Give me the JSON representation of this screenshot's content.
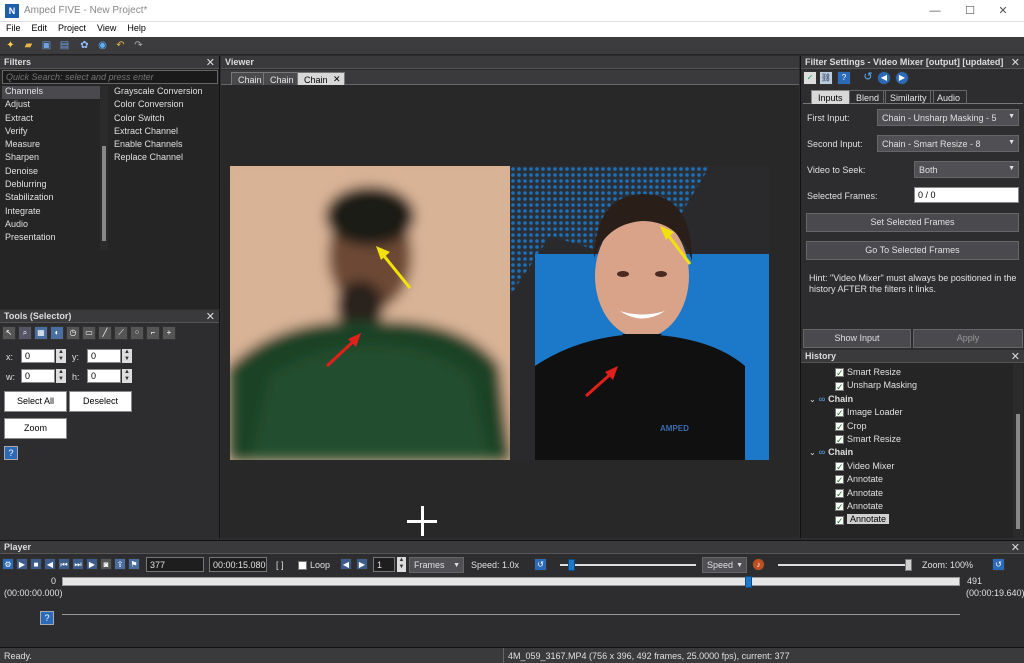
{
  "window": {
    "app_icon": "amped-logo-icon",
    "title": "Amped FIVE - New Project*",
    "controls": {
      "minimize": "—",
      "maximize": "☐",
      "close": "✕"
    }
  },
  "menu": [
    "File",
    "Edit",
    "Project",
    "View",
    "Help"
  ],
  "filters_panel": {
    "title": "Filters",
    "search_placeholder": "Quick Search: select and press enter",
    "categories": [
      "Channels",
      "Adjust",
      "Extract",
      "Verify",
      "Measure",
      "Sharpen",
      "Denoise",
      "Deblurring",
      "Stabilization",
      "Integrate",
      "Audio",
      "Presentation"
    ],
    "items": [
      "Grayscale Conversion",
      "Color Conversion",
      "Color Switch",
      "Extract Channel",
      "Enable Channels",
      "Replace Channel"
    ]
  },
  "tools_panel": {
    "title": "Tools (Selector)",
    "x_label": "x:",
    "x_value": "0",
    "y_label": "y:",
    "y_value": "0",
    "w_label": "w:",
    "w_value": "0",
    "h_label": "h:",
    "h_value": "0",
    "select_all": "Select All",
    "deselect": "Deselect",
    "zoom": "Zoom"
  },
  "viewer": {
    "title": "Viewer",
    "tabs": [
      "Chain",
      "Chain",
      "Chain"
    ],
    "active_tab": 2
  },
  "filter_settings": {
    "title": "Filter Settings - Video Mixer [output] [updated]",
    "tabs": [
      "Inputs",
      "Blend",
      "Similarity",
      "Audio"
    ],
    "first_input_label": "First Input:",
    "first_input_value": "Chain - Unsharp Masking - 5",
    "second_input_label": "Second Input:",
    "second_input_value": "Chain - Smart Resize - 8",
    "video_to_seek_label": "Video to Seek:",
    "video_to_seek_value": "Both",
    "selected_frames_label": "Selected Frames:",
    "selected_frames_value": "0 / 0",
    "set_selected_frames": "Set Selected Frames",
    "go_to_selected_frames": "Go To Selected Frames",
    "hint": "Hint: \"Video Mixer\" must always be positioned in the history AFTER the filters it links.",
    "show_input": "Show Input",
    "apply": "Apply"
  },
  "history": {
    "title": "History",
    "rows": [
      {
        "label": "Smart Resize",
        "type": "filter"
      },
      {
        "label": "Unsharp Masking",
        "type": "filter"
      },
      {
        "label": "Chain",
        "type": "chain"
      },
      {
        "label": "Image Loader",
        "type": "filter"
      },
      {
        "label": "Crop",
        "type": "filter"
      },
      {
        "label": "Smart Resize",
        "type": "filter"
      },
      {
        "label": "Chain",
        "type": "chain"
      },
      {
        "label": "Video Mixer",
        "type": "filter"
      },
      {
        "label": "Annotate",
        "type": "filter"
      },
      {
        "label": "Annotate",
        "type": "filter"
      },
      {
        "label": "Annotate",
        "type": "filter"
      },
      {
        "label": "Annotate",
        "type": "filter",
        "selected": true
      }
    ]
  },
  "player": {
    "title": "Player",
    "frame": "377",
    "time": "00:00:15.080",
    "brackets": "[ ]",
    "loop": "Loop",
    "step": "1",
    "unit": "Frames",
    "speed_label": "Speed:",
    "speed_value": "1.0x",
    "speed_mode": "Speed",
    "zoom_label": "Zoom:",
    "zoom_value": "100%",
    "start_frame": "0",
    "start_time": "(00:00:00.000)",
    "end_frame": "491",
    "end_time": "(00:00:19.640)",
    "speed_position": 0.06,
    "zoom_position": 1.0,
    "playhead_position": 0.767
  },
  "status": {
    "left": "Ready.",
    "right": "4M_059_3167.MP4 (756 x 396, 492 frames, 25.0000 fps), current: 377"
  },
  "colors": {
    "arrow_yellow": "#f2e20c",
    "arrow_red": "#e0201a",
    "accent_blue": "#1c78c8"
  }
}
